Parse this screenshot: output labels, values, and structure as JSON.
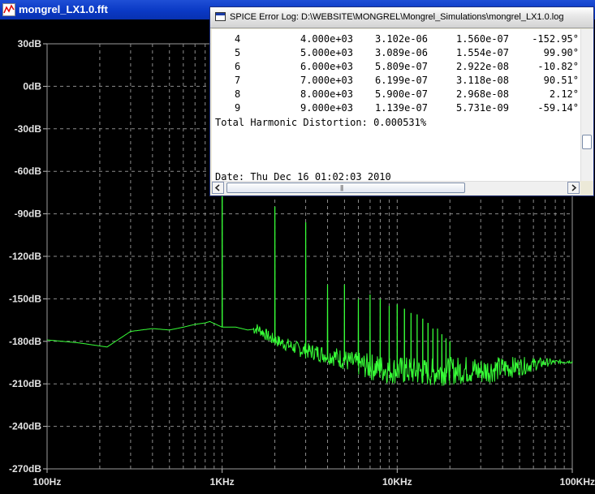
{
  "fft_window": {
    "title": "mongrel_LX1.0.fft"
  },
  "log_window": {
    "title": "SPICE Error Log: D:\\WEBSITE\\MONGREL\\Mongrel_Simulations\\mongrel_LX1.0.log",
    "rows": [
      {
        "n": "4",
        "freq": "4.000e+03",
        "fourier": "3.102e-06",
        "normalized": "1.560e-07",
        "phase": "-152.95°"
      },
      {
        "n": "5",
        "freq": "5.000e+03",
        "fourier": "3.089e-06",
        "normalized": "1.554e-07",
        "phase": "99.90°"
      },
      {
        "n": "6",
        "freq": "6.000e+03",
        "fourier": "5.809e-07",
        "normalized": "2.922e-08",
        "phase": "-10.82°"
      },
      {
        "n": "7",
        "freq": "7.000e+03",
        "fourier": "6.199e-07",
        "normalized": "3.118e-08",
        "phase": "90.51°"
      },
      {
        "n": "8",
        "freq": "8.000e+03",
        "fourier": "5.900e-07",
        "normalized": "2.968e-08",
        "phase": "2.12°"
      },
      {
        "n": "9",
        "freq": "9.000e+03",
        "fourier": "1.139e-07",
        "normalized": "5.731e-09",
        "phase": "-59.14°"
      }
    ],
    "thd_line": "Total Harmonic Distortion: 0.000531%",
    "date_line": "Date: Thu Dec 16 01:02:03 2010"
  },
  "chart_data": {
    "type": "line",
    "title": "",
    "xlabel": "",
    "ylabel": "",
    "x_scale": "log",
    "xlim": [
      100,
      100000
    ],
    "ylim": [
      -270,
      30
    ],
    "x_ticks": [
      {
        "value": 100,
        "label": "100Hz"
      },
      {
        "value": 1000,
        "label": "1KHz"
      },
      {
        "value": 10000,
        "label": "10KHz"
      },
      {
        "value": 100000,
        "label": "100KHz"
      }
    ],
    "y_ticks": [
      {
        "value": 30,
        "label": "30dB"
      },
      {
        "value": 0,
        "label": "0dB"
      },
      {
        "value": -30,
        "label": "-30dB"
      },
      {
        "value": -60,
        "label": "-60dB"
      },
      {
        "value": -90,
        "label": "-90dB"
      },
      {
        "value": -120,
        "label": "-120dB"
      },
      {
        "value": -150,
        "label": "-150dB"
      },
      {
        "value": -180,
        "label": "-180dB"
      },
      {
        "value": -210,
        "label": "-210dB"
      },
      {
        "value": -240,
        "label": "-240dB"
      },
      {
        "value": -270,
        "label": "-270dB"
      }
    ],
    "grid": true,
    "colors": {
      "background": "#000000",
      "trace": "#37ff37",
      "grid": "#8c8c8c"
    },
    "series": [
      {
        "noise_floor": [
          [
            100,
            -179
          ],
          [
            150,
            -181
          ],
          [
            220,
            -184
          ],
          [
            300,
            -173
          ],
          [
            400,
            -171
          ],
          [
            500,
            -172
          ],
          [
            600,
            -170
          ],
          [
            700,
            -168
          ],
          [
            800,
            -167
          ],
          [
            850,
            -166
          ],
          [
            1000,
            -170
          ],
          [
            1200,
            -170
          ],
          [
            1400,
            -172
          ],
          [
            1600,
            -171
          ],
          [
            1900,
            -178
          ],
          [
            2200,
            -181
          ],
          [
            2800,
            -186
          ],
          [
            3500,
            -188
          ],
          [
            4500,
            -191
          ],
          [
            5500,
            -195
          ],
          [
            7000,
            -198
          ],
          [
            9000,
            -200
          ],
          [
            12000,
            -201
          ],
          [
            15000,
            -202
          ],
          [
            20000,
            -201
          ],
          [
            25000,
            -200
          ],
          [
            30000,
            -201
          ],
          [
            40000,
            -199
          ],
          [
            55000,
            -197
          ],
          [
            70000,
            -195
          ],
          [
            100000,
            -194
          ]
        ],
        "peaks": [
          [
            1000,
            2
          ],
          [
            2000,
            -85
          ],
          [
            3000,
            -96
          ],
          [
            4000,
            -140
          ],
          [
            5000,
            -140
          ],
          [
            6000,
            -150
          ],
          [
            7000,
            -147
          ],
          [
            8000,
            -150
          ],
          [
            9000,
            -155
          ],
          [
            10000,
            -154
          ],
          [
            11000,
            -157
          ],
          [
            12000,
            -160
          ],
          [
            13000,
            -161
          ],
          [
            14000,
            -164
          ],
          [
            15000,
            -167
          ],
          [
            16000,
            -171
          ],
          [
            17000,
            -171
          ],
          [
            18000,
            -175
          ],
          [
            19000,
            -178
          ],
          [
            20000,
            -180
          ]
        ]
      }
    ]
  }
}
